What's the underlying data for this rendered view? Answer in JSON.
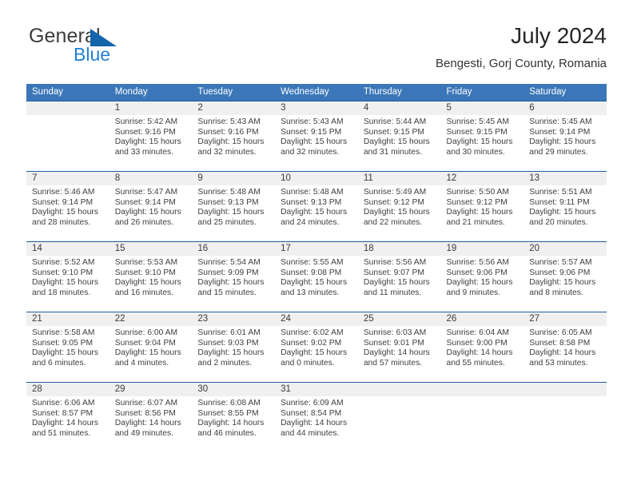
{
  "brand": {
    "name_top": "General",
    "name_bottom": "Blue",
    "triangle_color": "#1464aa",
    "blue_color": "#1f7fd4"
  },
  "header": {
    "title": "July 2024",
    "subtitle": "Bengesti, Gorj County, Romania"
  },
  "theme": {
    "header_bg": "#3b77b8",
    "header_text": "#ffffff",
    "row_divider": "#1f5fa0",
    "daynum_band": "#f0f0f0"
  },
  "weekdays": [
    "Sunday",
    "Monday",
    "Tuesday",
    "Wednesday",
    "Thursday",
    "Friday",
    "Saturday"
  ],
  "labels": {
    "sunrise_prefix": "Sunrise:",
    "sunset_prefix": "Sunset:",
    "daylight_prefix": "Daylight:"
  },
  "weeks": [
    [
      {
        "day": "",
        "sunrise": "",
        "sunset": "",
        "daylight_line1": "",
        "daylight_line2": ""
      },
      {
        "day": "1",
        "sunrise": "Sunrise: 5:42 AM",
        "sunset": "Sunset: 9:16 PM",
        "daylight_line1": "Daylight: 15 hours",
        "daylight_line2": "and 33 minutes."
      },
      {
        "day": "2",
        "sunrise": "Sunrise: 5:43 AM",
        "sunset": "Sunset: 9:16 PM",
        "daylight_line1": "Daylight: 15 hours",
        "daylight_line2": "and 32 minutes."
      },
      {
        "day": "3",
        "sunrise": "Sunrise: 5:43 AM",
        "sunset": "Sunset: 9:15 PM",
        "daylight_line1": "Daylight: 15 hours",
        "daylight_line2": "and 32 minutes."
      },
      {
        "day": "4",
        "sunrise": "Sunrise: 5:44 AM",
        "sunset": "Sunset: 9:15 PM",
        "daylight_line1": "Daylight: 15 hours",
        "daylight_line2": "and 31 minutes."
      },
      {
        "day": "5",
        "sunrise": "Sunrise: 5:45 AM",
        "sunset": "Sunset: 9:15 PM",
        "daylight_line1": "Daylight: 15 hours",
        "daylight_line2": "and 30 minutes."
      },
      {
        "day": "6",
        "sunrise": "Sunrise: 5:45 AM",
        "sunset": "Sunset: 9:14 PM",
        "daylight_line1": "Daylight: 15 hours",
        "daylight_line2": "and 29 minutes."
      }
    ],
    [
      {
        "day": "7",
        "sunrise": "Sunrise: 5:46 AM",
        "sunset": "Sunset: 9:14 PM",
        "daylight_line1": "Daylight: 15 hours",
        "daylight_line2": "and 28 minutes."
      },
      {
        "day": "8",
        "sunrise": "Sunrise: 5:47 AM",
        "sunset": "Sunset: 9:14 PM",
        "daylight_line1": "Daylight: 15 hours",
        "daylight_line2": "and 26 minutes."
      },
      {
        "day": "9",
        "sunrise": "Sunrise: 5:48 AM",
        "sunset": "Sunset: 9:13 PM",
        "daylight_line1": "Daylight: 15 hours",
        "daylight_line2": "and 25 minutes."
      },
      {
        "day": "10",
        "sunrise": "Sunrise: 5:48 AM",
        "sunset": "Sunset: 9:13 PM",
        "daylight_line1": "Daylight: 15 hours",
        "daylight_line2": "and 24 minutes."
      },
      {
        "day": "11",
        "sunrise": "Sunrise: 5:49 AM",
        "sunset": "Sunset: 9:12 PM",
        "daylight_line1": "Daylight: 15 hours",
        "daylight_line2": "and 22 minutes."
      },
      {
        "day": "12",
        "sunrise": "Sunrise: 5:50 AM",
        "sunset": "Sunset: 9:12 PM",
        "daylight_line1": "Daylight: 15 hours",
        "daylight_line2": "and 21 minutes."
      },
      {
        "day": "13",
        "sunrise": "Sunrise: 5:51 AM",
        "sunset": "Sunset: 9:11 PM",
        "daylight_line1": "Daylight: 15 hours",
        "daylight_line2": "and 20 minutes."
      }
    ],
    [
      {
        "day": "14",
        "sunrise": "Sunrise: 5:52 AM",
        "sunset": "Sunset: 9:10 PM",
        "daylight_line1": "Daylight: 15 hours",
        "daylight_line2": "and 18 minutes."
      },
      {
        "day": "15",
        "sunrise": "Sunrise: 5:53 AM",
        "sunset": "Sunset: 9:10 PM",
        "daylight_line1": "Daylight: 15 hours",
        "daylight_line2": "and 16 minutes."
      },
      {
        "day": "16",
        "sunrise": "Sunrise: 5:54 AM",
        "sunset": "Sunset: 9:09 PM",
        "daylight_line1": "Daylight: 15 hours",
        "daylight_line2": "and 15 minutes."
      },
      {
        "day": "17",
        "sunrise": "Sunrise: 5:55 AM",
        "sunset": "Sunset: 9:08 PM",
        "daylight_line1": "Daylight: 15 hours",
        "daylight_line2": "and 13 minutes."
      },
      {
        "day": "18",
        "sunrise": "Sunrise: 5:56 AM",
        "sunset": "Sunset: 9:07 PM",
        "daylight_line1": "Daylight: 15 hours",
        "daylight_line2": "and 11 minutes."
      },
      {
        "day": "19",
        "sunrise": "Sunrise: 5:56 AM",
        "sunset": "Sunset: 9:06 PM",
        "daylight_line1": "Daylight: 15 hours",
        "daylight_line2": "and 9 minutes."
      },
      {
        "day": "20",
        "sunrise": "Sunrise: 5:57 AM",
        "sunset": "Sunset: 9:06 PM",
        "daylight_line1": "Daylight: 15 hours",
        "daylight_line2": "and 8 minutes."
      }
    ],
    [
      {
        "day": "21",
        "sunrise": "Sunrise: 5:58 AM",
        "sunset": "Sunset: 9:05 PM",
        "daylight_line1": "Daylight: 15 hours",
        "daylight_line2": "and 6 minutes."
      },
      {
        "day": "22",
        "sunrise": "Sunrise: 6:00 AM",
        "sunset": "Sunset: 9:04 PM",
        "daylight_line1": "Daylight: 15 hours",
        "daylight_line2": "and 4 minutes."
      },
      {
        "day": "23",
        "sunrise": "Sunrise: 6:01 AM",
        "sunset": "Sunset: 9:03 PM",
        "daylight_line1": "Daylight: 15 hours",
        "daylight_line2": "and 2 minutes."
      },
      {
        "day": "24",
        "sunrise": "Sunrise: 6:02 AM",
        "sunset": "Sunset: 9:02 PM",
        "daylight_line1": "Daylight: 15 hours",
        "daylight_line2": "and 0 minutes."
      },
      {
        "day": "25",
        "sunrise": "Sunrise: 6:03 AM",
        "sunset": "Sunset: 9:01 PM",
        "daylight_line1": "Daylight: 14 hours",
        "daylight_line2": "and 57 minutes."
      },
      {
        "day": "26",
        "sunrise": "Sunrise: 6:04 AM",
        "sunset": "Sunset: 9:00 PM",
        "daylight_line1": "Daylight: 14 hours",
        "daylight_line2": "and 55 minutes."
      },
      {
        "day": "27",
        "sunrise": "Sunrise: 6:05 AM",
        "sunset": "Sunset: 8:58 PM",
        "daylight_line1": "Daylight: 14 hours",
        "daylight_line2": "and 53 minutes."
      }
    ],
    [
      {
        "day": "28",
        "sunrise": "Sunrise: 6:06 AM",
        "sunset": "Sunset: 8:57 PM",
        "daylight_line1": "Daylight: 14 hours",
        "daylight_line2": "and 51 minutes."
      },
      {
        "day": "29",
        "sunrise": "Sunrise: 6:07 AM",
        "sunset": "Sunset: 8:56 PM",
        "daylight_line1": "Daylight: 14 hours",
        "daylight_line2": "and 49 minutes."
      },
      {
        "day": "30",
        "sunrise": "Sunrise: 6:08 AM",
        "sunset": "Sunset: 8:55 PM",
        "daylight_line1": "Daylight: 14 hours",
        "daylight_line2": "and 46 minutes."
      },
      {
        "day": "31",
        "sunrise": "Sunrise: 6:09 AM",
        "sunset": "Sunset: 8:54 PM",
        "daylight_line1": "Daylight: 14 hours",
        "daylight_line2": "and 44 minutes."
      },
      {
        "day": "",
        "sunrise": "",
        "sunset": "",
        "daylight_line1": "",
        "daylight_line2": ""
      },
      {
        "day": "",
        "sunrise": "",
        "sunset": "",
        "daylight_line1": "",
        "daylight_line2": ""
      },
      {
        "day": "",
        "sunrise": "",
        "sunset": "",
        "daylight_line1": "",
        "daylight_line2": ""
      }
    ]
  ]
}
